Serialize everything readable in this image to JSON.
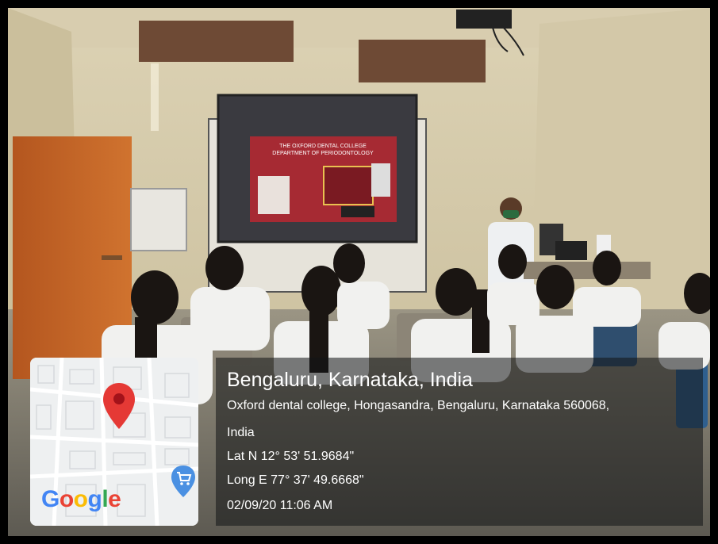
{
  "photo": {
    "slide_lines": [
      "THE OXFORD DENTAL COLLEGE",
      "DEPARTMENT OF PERIODONTOLOGY"
    ]
  },
  "location": {
    "title": "Bengaluru, Karnataka, India",
    "address_line1": "Oxford dental college, Hongasandra, Bengaluru, Karnataka 560068,",
    "address_line2": "India",
    "latitude": "Lat N 12° 53' 51.9684\"",
    "longitude": "Long E 77° 37' 49.6668\"",
    "datetime": "02/09/20 11:06 AM"
  },
  "map": {
    "logo": "Google",
    "logo_colors": [
      "#4285F4",
      "#EA4335",
      "#FBBC05",
      "#4285F4",
      "#34A853",
      "#EA4335"
    ],
    "pin_icon": "map-pin-icon",
    "shopping_icon": "shopping-cart-icon",
    "pin_color": "#E53935",
    "shopping_color": "#4A90E2"
  }
}
